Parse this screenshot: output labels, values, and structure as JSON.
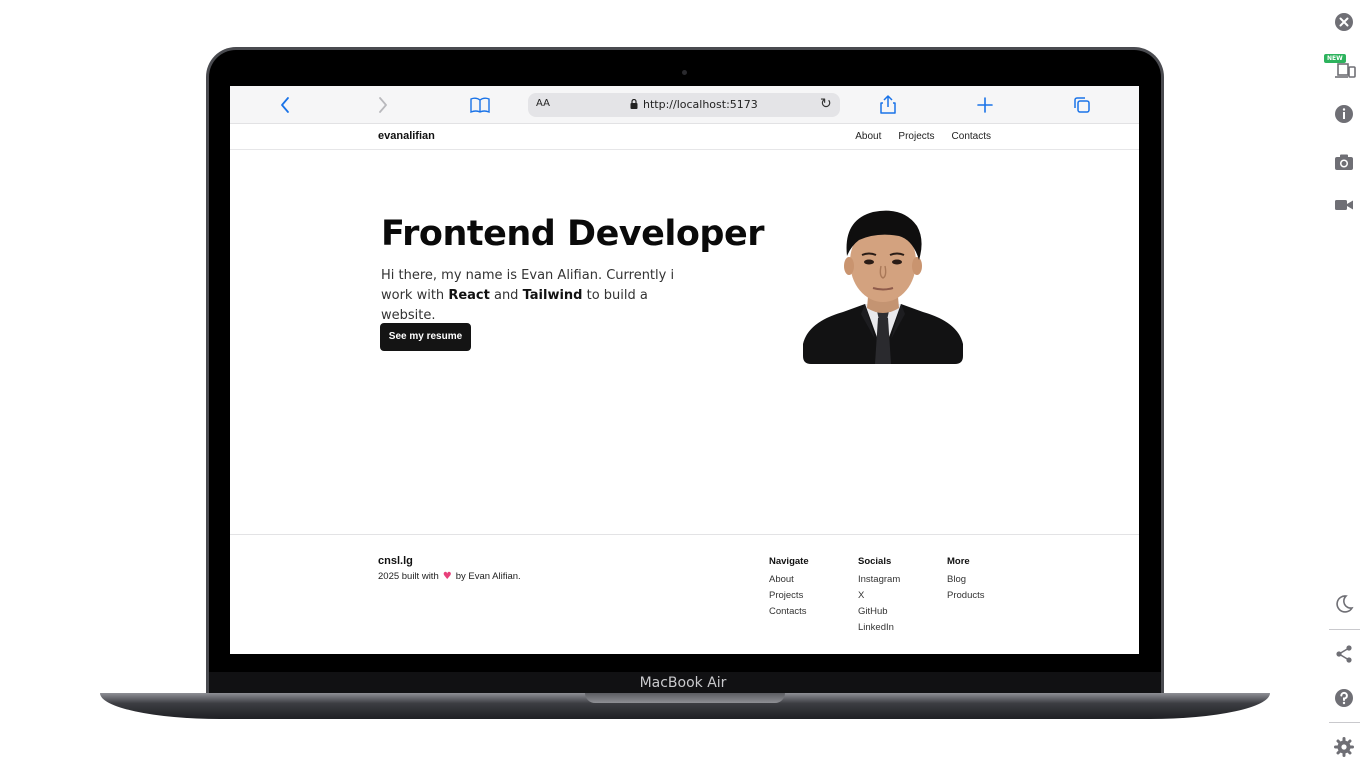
{
  "device": {
    "label": "MacBook Air"
  },
  "browser": {
    "reader_label": "AA",
    "url": "http://localhost:5173"
  },
  "site": {
    "brand": "evanalifian",
    "nav": [
      "About",
      "Projects",
      "Contacts"
    ]
  },
  "hero": {
    "title": "Frontend Developer",
    "intro_1": "Hi there, my name is Evan Alifian. Currently i work with ",
    "tech_1": "React",
    "and": " and ",
    "tech_2": "Tailwind",
    "intro_2": " to build a website.",
    "button": "See my resume"
  },
  "footer": {
    "brand": "cnsl.lg",
    "copy_prefix": "2025 built with",
    "copy_suffix": "by Evan Alifian.",
    "columns": [
      {
        "title": "Navigate",
        "items": [
          "About",
          "Projects",
          "Contacts"
        ]
      },
      {
        "title": "Socials",
        "items": [
          "Instagram",
          "X",
          "GitHub",
          "LinkedIn"
        ]
      },
      {
        "title": "More",
        "items": [
          "Blog",
          "Products"
        ]
      }
    ]
  },
  "extension_panel": {
    "badge": "NEW",
    "icons": [
      "close-icon",
      "device-icon",
      "info-icon",
      "camera-icon",
      "video-icon",
      "moon-icon",
      "share-icon",
      "help-icon",
      "settings-icon"
    ]
  },
  "colors": {
    "accent": "#1a73e8",
    "button_bg": "#141414",
    "heart": "#e8407a",
    "badge": "#2db35d"
  }
}
